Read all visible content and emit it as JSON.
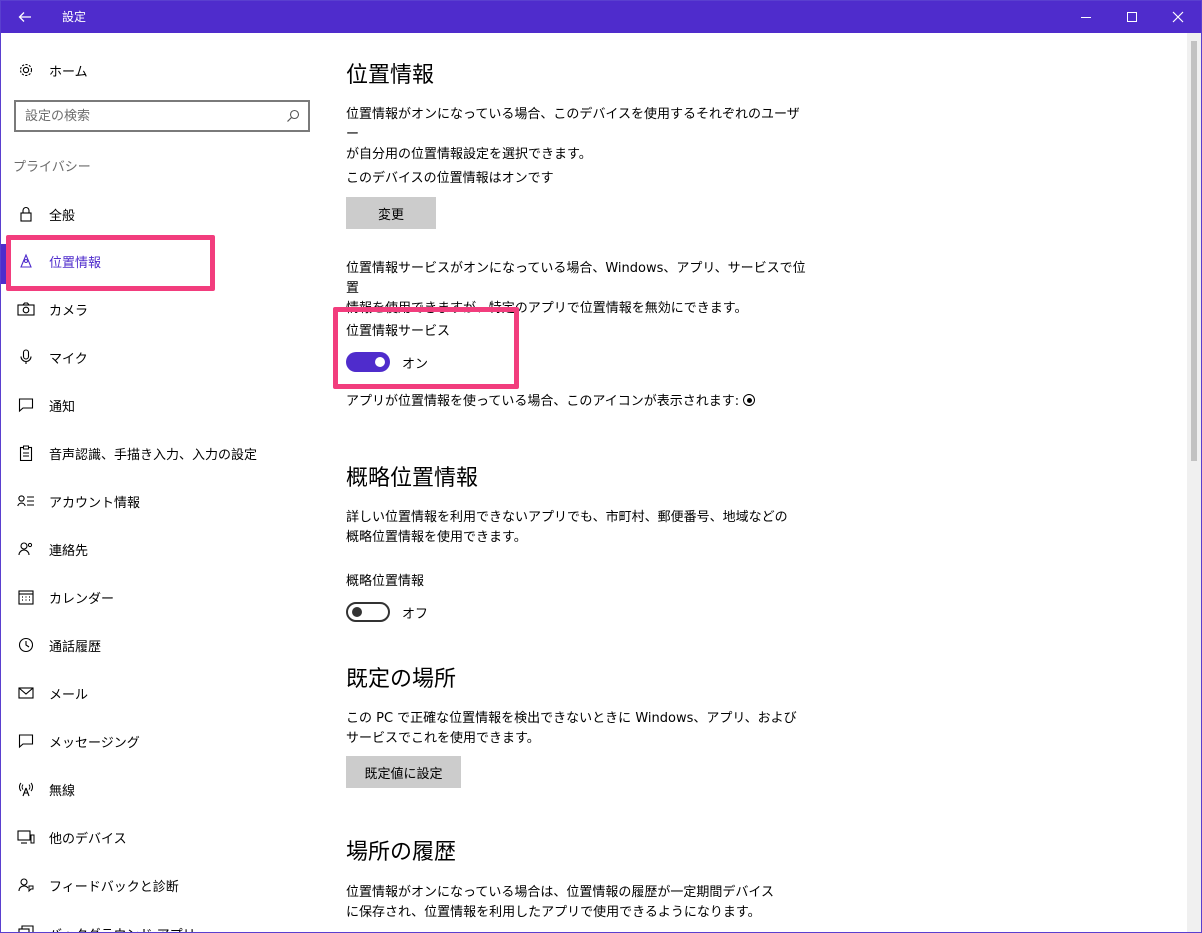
{
  "window": {
    "title": "設定",
    "back_icon": "arrow-left-icon",
    "controls": [
      "minimize-icon",
      "maximize-icon",
      "close-icon"
    ],
    "accent": "#4f2ccc",
    "highlight": "#f23d7d"
  },
  "sidebar": {
    "home_label": "ホーム",
    "search_placeholder": "設定の検索",
    "section_label": "プライバシー",
    "items": [
      {
        "label": "全般",
        "icon": "lock-icon"
      },
      {
        "label": "位置情報",
        "icon": "location-icon",
        "active": true
      },
      {
        "label": "カメラ",
        "icon": "camera-icon"
      },
      {
        "label": "マイク",
        "icon": "microphone-icon"
      },
      {
        "label": "通知",
        "icon": "notification-icon"
      },
      {
        "label": "音声認識、手描き入力、入力の設定",
        "icon": "clipboard-icon"
      },
      {
        "label": "アカウント情報",
        "icon": "account-info-icon"
      },
      {
        "label": "連絡先",
        "icon": "contacts-icon"
      },
      {
        "label": "カレンダー",
        "icon": "calendar-icon"
      },
      {
        "label": "通話履歴",
        "icon": "call-history-icon"
      },
      {
        "label": "メール",
        "icon": "mail-icon"
      },
      {
        "label": "メッセージング",
        "icon": "messaging-icon"
      },
      {
        "label": "無線",
        "icon": "radio-icon"
      },
      {
        "label": "他のデバイス",
        "icon": "devices-icon"
      },
      {
        "label": "フィードバックと診断",
        "icon": "feedback-icon"
      },
      {
        "label": "バックグラウンド アプリ",
        "icon": "background-apps-icon"
      }
    ]
  },
  "main": {
    "location": {
      "heading": "位置情報",
      "description_line1": "位置情報がオンになっている場合、このデバイスを使用するそれぞれのユーザー",
      "description_line2": "が自分用の位置情報設定を選択できます。",
      "device_status": "このデバイスの位置情報はオンです",
      "change_button": "変更",
      "service_description_line1": "位置情報サービスがオンになっている場合、Windows、アプリ、サービスで位置",
      "service_description_line2": "情報を使用できますが、特定のアプリで位置情報を無効にできます。",
      "service_label": "位置情報サービス",
      "service_state": "オン",
      "icon_note": "アプリが位置情報を使っている場合、このアイコンが表示されます:"
    },
    "approximate": {
      "heading": "概略位置情報",
      "description_line1": "詳しい位置情報を利用できないアプリでも、市町村、郵便番号、地域などの",
      "description_line2": "概略位置情報を使用できます。",
      "toggle_label": "概略位置情報",
      "toggle_state": "オフ"
    },
    "default_location": {
      "heading": "既定の場所",
      "description_line1": "この PC で正確な位置情報を検出できないときに Windows、アプリ、および",
      "description_line2": "サービスでこれを使用できます。",
      "set_button": "既定値に設定"
    },
    "history": {
      "heading": "場所の履歴",
      "description_line1": "位置情報がオンになっている場合は、位置情報の履歴が一定期間デバイス",
      "description_line2": "に保存され、位置情報を利用したアプリで使用できるようになります。"
    }
  }
}
